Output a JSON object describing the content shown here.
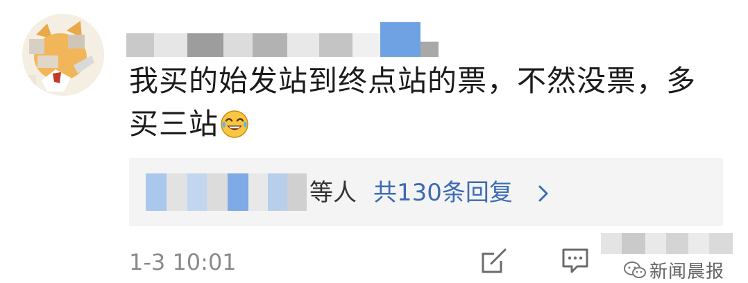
{
  "comment": {
    "text": "我买的始发站到终点站的票，不然没票，多买三站",
    "emoji": "laughing-tears-emoji"
  },
  "replies": {
    "suffix": "等人",
    "link_label": "共130条回复",
    "chevron": "chevron-right-icon"
  },
  "footer": {
    "timestamp": "1-3 10:01",
    "share_icon": "share-icon",
    "comment_icon": "comment-icon"
  },
  "watermark": {
    "text": "新闻晨报"
  },
  "colors": {
    "link": "#3c6bb5",
    "text": "#1b1b1b",
    "meta": "#8a8a8a",
    "reply_bg": "#f4f4f4"
  }
}
